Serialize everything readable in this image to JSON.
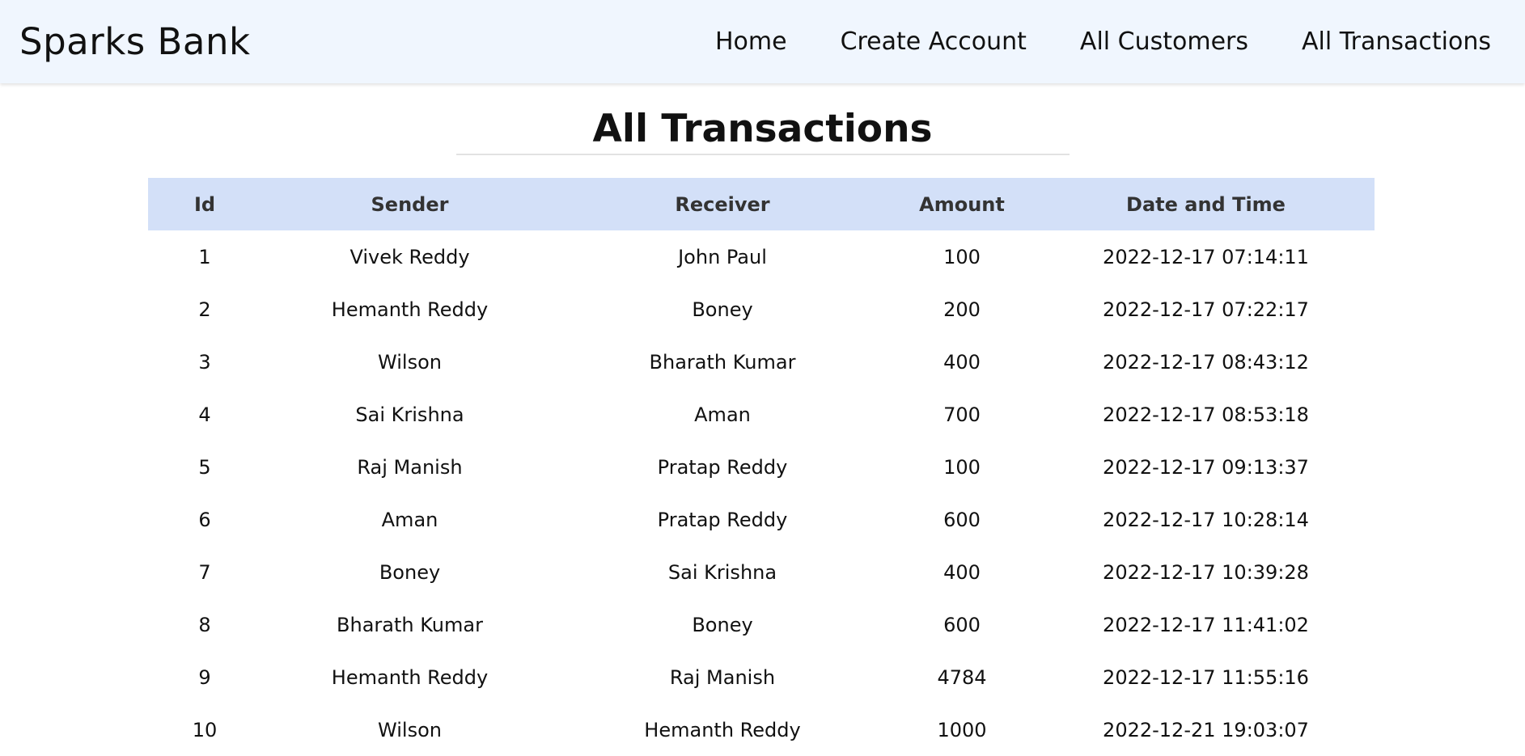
{
  "nav": {
    "brand": "Sparks Bank",
    "links": [
      "Home",
      "Create Account",
      "All Customers",
      "All Transactions"
    ]
  },
  "page": {
    "title": "All Transactions"
  },
  "table": {
    "headers": [
      "Id",
      "Sender",
      "Receiver",
      "Amount",
      "Date and Time"
    ],
    "rows": [
      [
        "1",
        "Vivek Reddy",
        "John Paul",
        "100",
        "2022-12-17 07:14:11"
      ],
      [
        "2",
        "Hemanth Reddy",
        "Boney",
        "200",
        "2022-12-17 07:22:17"
      ],
      [
        "3",
        "Wilson",
        "Bharath Kumar",
        "400",
        "2022-12-17 08:43:12"
      ],
      [
        "4",
        "Sai Krishna",
        "Aman",
        "700",
        "2022-12-17 08:53:18"
      ],
      [
        "5",
        "Raj Manish",
        "Pratap Reddy",
        "100",
        "2022-12-17 09:13:37"
      ],
      [
        "6",
        "Aman",
        "Pratap Reddy",
        "600",
        "2022-12-17 10:28:14"
      ],
      [
        "7",
        "Boney",
        "Sai Krishna",
        "400",
        "2022-12-17 10:39:28"
      ],
      [
        "8",
        "Bharath Kumar",
        "Boney",
        "600",
        "2022-12-17 11:41:02"
      ],
      [
        "9",
        "Hemanth Reddy",
        "Raj Manish",
        "4784",
        "2022-12-17 11:55:16"
      ],
      [
        "10",
        "Wilson",
        "Hemanth Reddy",
        "1000",
        "2022-12-21 19:03:07"
      ]
    ]
  }
}
